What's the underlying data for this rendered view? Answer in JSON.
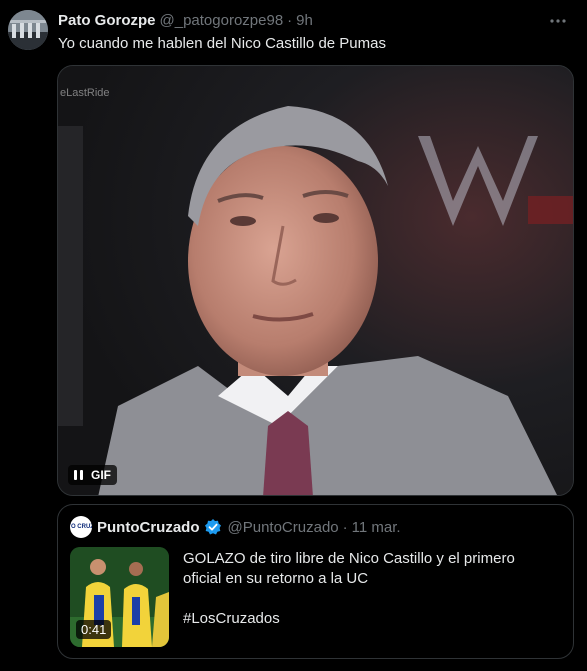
{
  "tweet": {
    "author_name": "Pato Gorozpe",
    "author_handle": "@_patogorozpe98",
    "separator": "·",
    "time": "9h",
    "text": "Yo cuando me hablen del Nico Castillo de Pumas",
    "avatar_icon": "profile-photo",
    "more_icon": "more-options-icon"
  },
  "media": {
    "type": "gif",
    "watermark": "eLastRide",
    "badge_label": "GIF",
    "control_icon": "pause-icon"
  },
  "quoted": {
    "author_name": "PuntoCruzado",
    "author_handle": "@PuntoCruzado",
    "separator": "·",
    "date": "11 mar.",
    "avatar_text": "PUNTO CRUZADO",
    "verified_color": "#1d9bf0",
    "video_duration": "0:41",
    "text_line": "GOLAZO de tiro libre de Nico Castillo y el primero oficial en su retorno a la UC",
    "hashtag": "#LosCruzados"
  },
  "colors": {
    "background": "#000000",
    "text_primary": "#e7e9ea",
    "text_secondary": "#71767b",
    "border": "#2f3336"
  }
}
